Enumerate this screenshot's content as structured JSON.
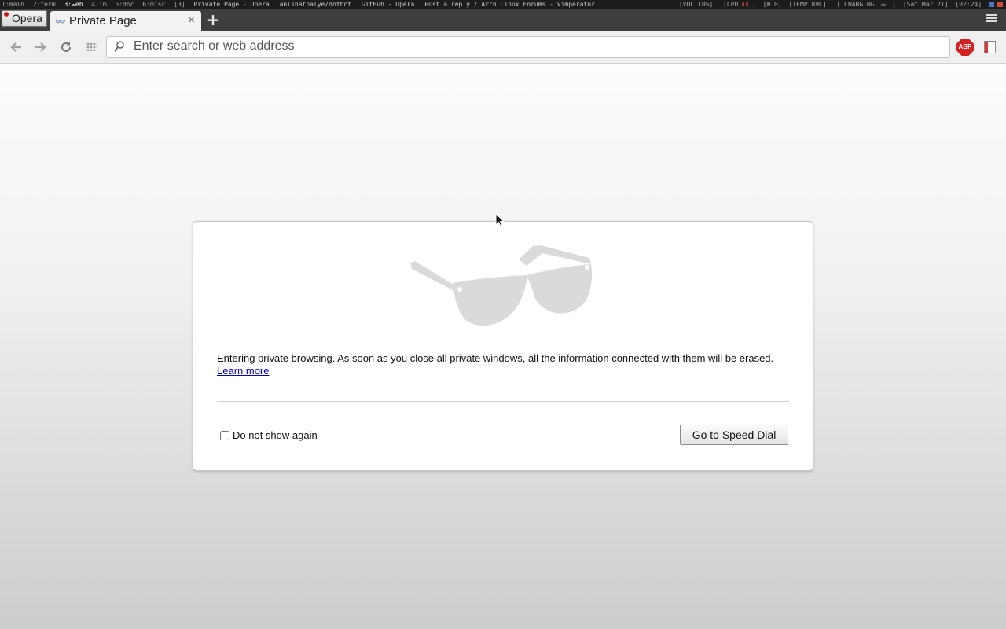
{
  "statusbar": {
    "workspaces": [
      "1:main",
      "2:term",
      "3:web",
      "4:im",
      "5:doc",
      "6:misc"
    ],
    "active_workspace": "3:web",
    "window_count": "[3]",
    "window_titles": [
      "Private Page - Opera",
      "anishathalye/dotbot",
      "GitHub - Opera",
      "Post a reply / Arch Linux Forums - Vimperator"
    ],
    "vol": "[VOL 18%]",
    "cpu": "[CPU",
    "cpu_tail": "]",
    "wifi": "[W 0]",
    "temp": "[TEMP 89C]",
    "battery": "[ CHARGING",
    "battery_tail": "]",
    "date": "[Sat Mar 21]",
    "time": "[02:24]"
  },
  "browser": {
    "menu_label": "Opera",
    "tab_title": "Private Page",
    "tab_close": "×",
    "new_tab": "+",
    "address_placeholder": "Enter search or web address",
    "address_value": "",
    "adblock_label": "ABP"
  },
  "dialog": {
    "message": "Entering private browsing. As soon as you close all private windows, all the information connected with them will be erased.",
    "learn_more": "Learn more",
    "checkbox_label": "Do not show again",
    "checkbox_checked": false,
    "button_label": "Go to Speed Dial"
  },
  "icons": {
    "back": "back-arrow-icon",
    "forward": "forward-arrow-icon",
    "reload": "reload-icon",
    "speed_dial": "grid-icon",
    "search": "search-icon",
    "adblock": "adblock-plus-icon",
    "sidebar": "sidebar-icon",
    "private": "sunglasses-icon"
  },
  "colors": {
    "accent_link": "#0000cc",
    "adblock": "#d32020"
  }
}
